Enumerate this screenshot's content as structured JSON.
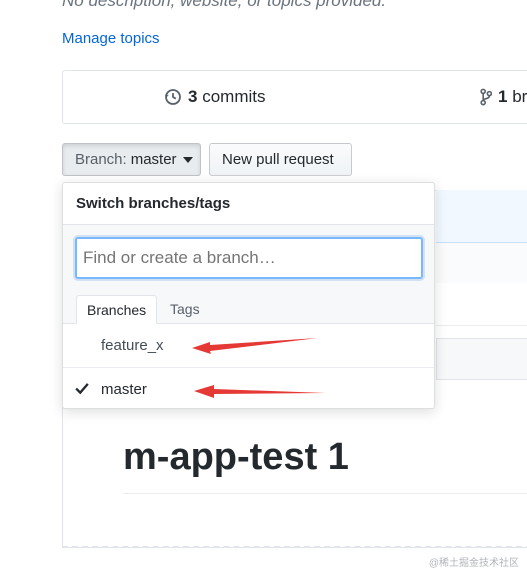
{
  "repo": {
    "description": "No description, website, or topics provided.",
    "manage_topics": "Manage topics",
    "title": "m-app-test 1"
  },
  "stats": {
    "commits_count": "3",
    "commits_label": "commits",
    "branches_count": "1",
    "branches_label": "br"
  },
  "toolbar": {
    "branch_prefix": "Branch:",
    "branch_name": "master",
    "new_pr": "New pull request"
  },
  "dropdown": {
    "header": "Switch branches/tags",
    "filter_placeholder": "Find or create a branch…",
    "tabs": [
      "Branches",
      "Tags"
    ],
    "items": [
      {
        "label": "feature_x",
        "selected": false
      },
      {
        "label": "master",
        "selected": true
      }
    ]
  },
  "annotation_color": "#e53935",
  "watermark": "@稀土掘金技术社区"
}
